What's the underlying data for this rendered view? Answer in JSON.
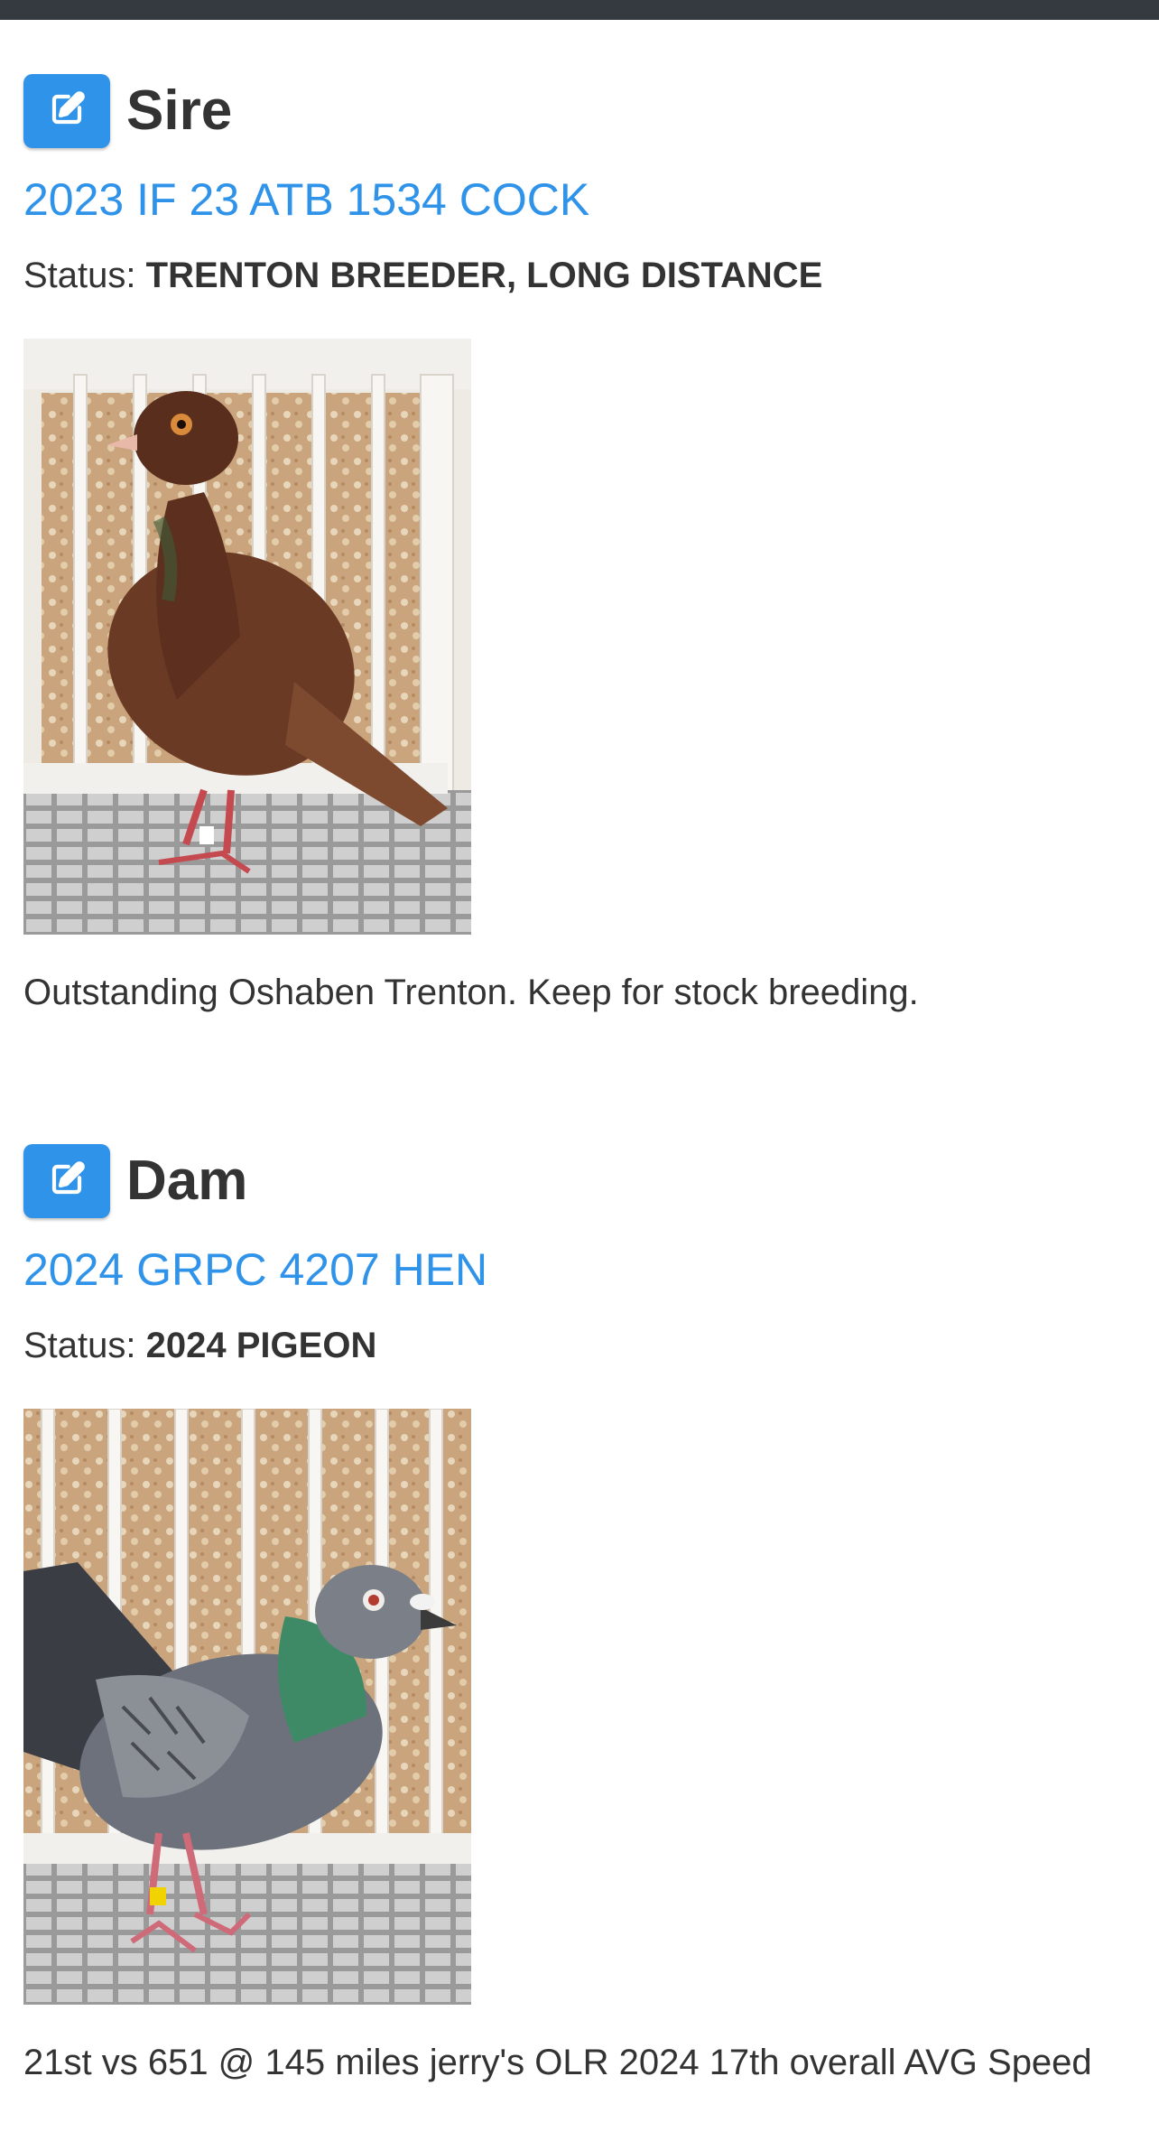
{
  "sire": {
    "role": "Sire",
    "band": "2023 IF 23 ATB 1534 COCK",
    "status_label": "Status:",
    "status_value": "TRENTON BREEDER, LONG DISTANCE",
    "note": "Outstanding Oshaben Trenton. Keep for stock breeding.",
    "edit_icon": "edit-icon",
    "photo_subject": "red-pigeon-in-cage"
  },
  "dam": {
    "role": "Dam",
    "band": "2024 GRPC 4207 HEN",
    "status_label": "Status:",
    "status_value": "2024 PIGEON",
    "note": "21st vs 651 @ 145 miles jerry's OLR 2024 17th overall AVG Speed",
    "edit_icon": "edit-icon",
    "photo_subject": "blue-checker-pigeon-in-cage"
  },
  "colors": {
    "accent": "#2f93ea",
    "topbar": "#343a40",
    "text": "#333333"
  }
}
